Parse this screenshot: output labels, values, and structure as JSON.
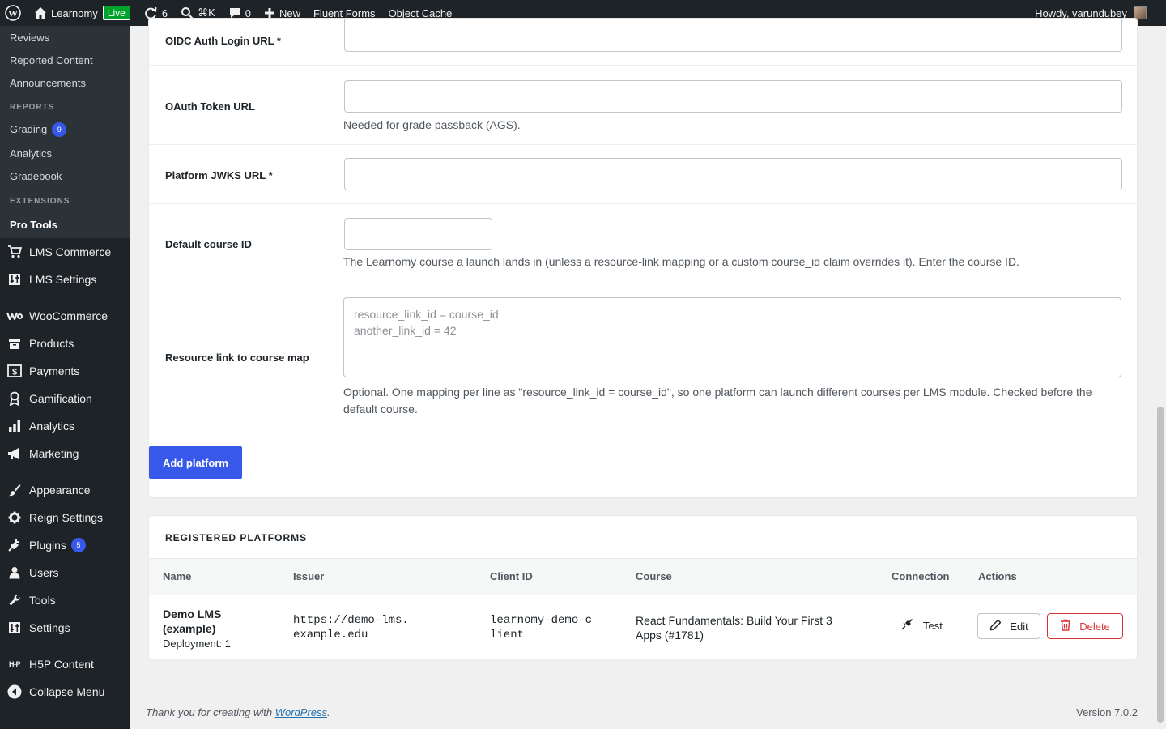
{
  "adminbar": {
    "site_name": "Learnomy",
    "live_label": "Live",
    "updates_count": "6",
    "search_shortcut": "⌘K",
    "comments_count": "0",
    "new_label": "New",
    "fluent_forms": "Fluent Forms",
    "object_cache": "Object Cache",
    "howdy": "Howdy, varundubey"
  },
  "sidebar": {
    "sub_items_top": [
      "Reviews",
      "Reported Content",
      "Announcements"
    ],
    "reports_heading": "REPORTS",
    "grading": "Grading",
    "grading_count": "9",
    "analytics_sub": "Analytics",
    "gradebook": "Gradebook",
    "extensions_heading": "EXTENSIONS",
    "pro_tools": "Pro Tools",
    "lms_commerce": "LMS Commerce",
    "lms_settings": "LMS Settings",
    "woocommerce": "WooCommerce",
    "products": "Products",
    "payments": "Payments",
    "gamification": "Gamification",
    "analytics": "Analytics",
    "marketing": "Marketing",
    "appearance": "Appearance",
    "reign_settings": "Reign Settings",
    "plugins": "Plugins",
    "plugins_count": "5",
    "users": "Users",
    "tools": "Tools",
    "settings": "Settings",
    "h5p": "H5P Content",
    "collapse": "Collapse Menu"
  },
  "form": {
    "oidc_label": "OIDC Auth Login URL *",
    "token_label": "OAuth Token URL",
    "token_help": "Needed for grade passback (AGS).",
    "jwks_label": "Platform JWKS URL *",
    "course_label": "Default course ID",
    "course_help": "The Learnomy course a launch lands in (unless a resource-link mapping or a custom course_id claim overrides it). Enter the course ID.",
    "map_label": "Resource link to course map",
    "map_placeholder": "resource_link_id = course_id\nanother_link_id = 42",
    "map_help": "Optional. One mapping per line as \"resource_link_id = course_id\", so one platform can launch different courses per LMS module. Checked before the default course.",
    "add_button": "Add platform"
  },
  "registered": {
    "title": "REGISTERED PLATFORMS",
    "columns": [
      "Name",
      "Issuer",
      "Client ID",
      "Course",
      "Connection",
      "Actions"
    ],
    "row": {
      "name": "Demo LMS (example)",
      "deployment": "Deployment: 1",
      "issuer": "https://demo-lms.example.edu",
      "client_id": "learnomy-demo-client",
      "course": "React Fundamentals: Build Your First 3 Apps (#1781)",
      "test": "Test",
      "edit": "Edit",
      "delete": "Delete"
    }
  },
  "footer": {
    "thanks_prefix": "Thank you for creating with ",
    "wordpress": "WordPress",
    "thanks_suffix": ".",
    "version": "Version 7.0.2"
  },
  "colors": {
    "accent": "#3858e9",
    "admin_dark": "#1d2327",
    "delete_red": "#d63638",
    "live_green": "#00a32a"
  }
}
